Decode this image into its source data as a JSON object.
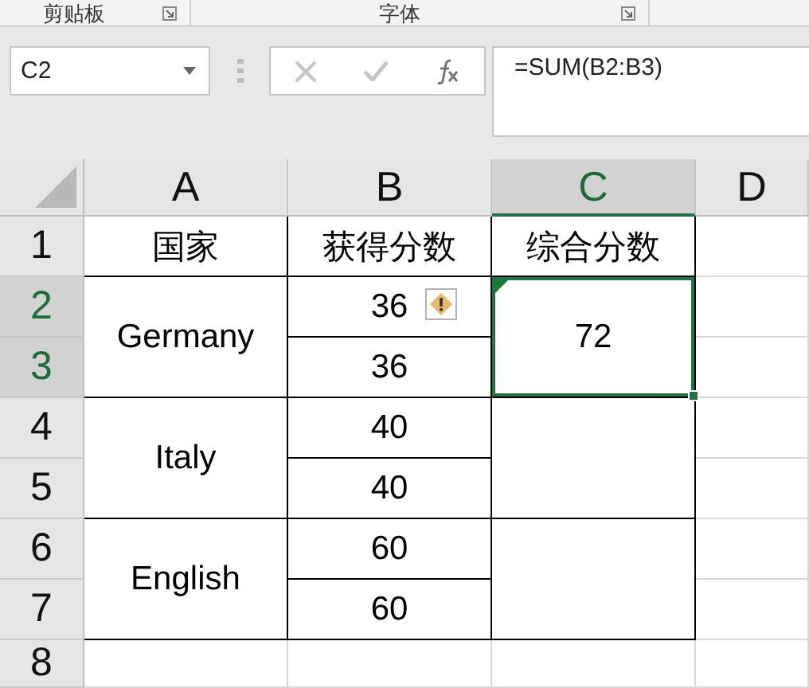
{
  "ribbon_groups": [
    {
      "label": "剪贴板"
    },
    {
      "label": "字体"
    }
  ],
  "formula_bar": {
    "name_box": "C2",
    "formula": "=SUM(B2:B3)"
  },
  "columns": [
    {
      "label": "A",
      "selected": false
    },
    {
      "label": "B",
      "selected": false
    },
    {
      "label": "C",
      "selected": true
    },
    {
      "label": "D",
      "selected": false
    }
  ],
  "rows": [
    {
      "label": "1",
      "selected": false
    },
    {
      "label": "2",
      "selected": true
    },
    {
      "label": "3",
      "selected": true
    },
    {
      "label": "4",
      "selected": false
    },
    {
      "label": "5",
      "selected": false
    },
    {
      "label": "6",
      "selected": false
    },
    {
      "label": "7",
      "selected": false
    },
    {
      "label": "8",
      "selected": false
    }
  ],
  "table": {
    "headers": [
      {
        "text": "国家",
        "selected": false
      },
      {
        "text": "获得分数",
        "selected": false
      },
      {
        "text": "综合分数",
        "selected": false
      }
    ],
    "groups": [
      {
        "country": {
          "text": "Germany",
          "selected": false
        },
        "scores": [
          {
            "text": "36",
            "selected": false,
            "warning": true
          },
          {
            "text": "36",
            "selected": false,
            "warning": false
          }
        ],
        "total": {
          "text": "72",
          "selected": true,
          "error_marker": true
        }
      },
      {
        "country": {
          "text": "Italy",
          "selected": false
        },
        "scores": [
          {
            "text": "40",
            "selected": false,
            "warning": false
          },
          {
            "text": "40",
            "selected": false,
            "warning": false
          }
        ],
        "total": {
          "selected": false,
          "error_marker": false
        }
      },
      {
        "country": {
          "text": "English",
          "selected": false
        },
        "scores": [
          {
            "text": "60",
            "selected": false,
            "warning": false
          },
          {
            "text": "60",
            "selected": false,
            "warning": false
          }
        ],
        "total": {
          "selected": false,
          "error_marker": false
        }
      }
    ]
  }
}
